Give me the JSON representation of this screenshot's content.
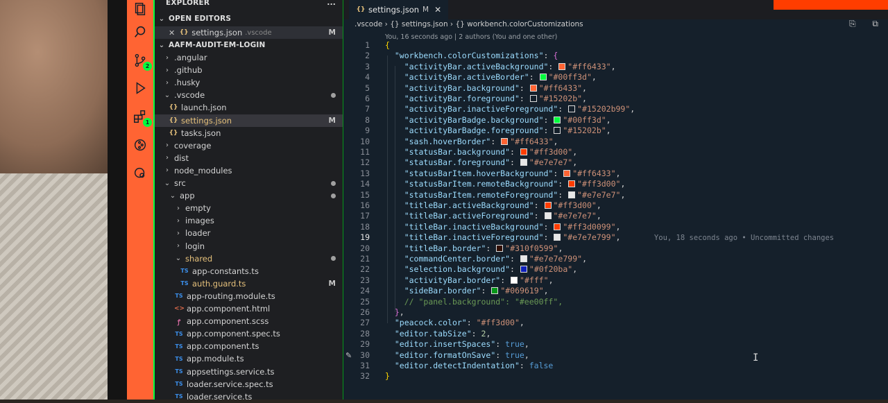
{
  "colors": {
    "activity_bar": "#ff6433",
    "activity_border": "#00ff3d",
    "editor_bg": "#15202b",
    "sidebar_border": "#069619",
    "title_bar": "#ff3d00"
  },
  "activity_bar": {
    "icons": [
      "explorer-icon",
      "search-icon",
      "source-control-icon",
      "run-debug-icon",
      "extensions-icon",
      "git-graph-icon",
      "remote-explorer-icon"
    ],
    "badges": {
      "source_control": "2",
      "extensions": "1"
    }
  },
  "sidebar": {
    "title": "EXPLORER",
    "more": "...",
    "open_editors_label": "OPEN EDITORS",
    "open_editor": {
      "close": "✕",
      "name": "settings.json",
      "folder": ".vscode",
      "status": "M"
    },
    "project_label": "AAFM-AUDIT-EM-LOGIN",
    "tree": [
      {
        "name": ".angular",
        "chevron": "›",
        "icon": ""
      },
      {
        "name": ".github",
        "chevron": "›",
        "icon": ""
      },
      {
        "name": ".husky",
        "chevron": "›",
        "icon": ""
      },
      {
        "name": ".vscode",
        "chevron": "⌄",
        "icon": "",
        "dot": true
      },
      {
        "name": "launch.json",
        "chevron": "",
        "icon": "{}"
      },
      {
        "name": "settings.json",
        "chevron": "",
        "icon": "{}",
        "status": "M",
        "active": true
      },
      {
        "name": "tasks.json",
        "chevron": "",
        "icon": "{}"
      },
      {
        "name": "coverage",
        "chevron": "›",
        "icon": ""
      },
      {
        "name": "dist",
        "chevron": "›",
        "icon": ""
      },
      {
        "name": "node_modules",
        "chevron": "›",
        "icon": ""
      },
      {
        "name": "src",
        "chevron": "⌄",
        "icon": "",
        "dot": true
      },
      {
        "name": "app",
        "chevron": "⌄",
        "icon": "",
        "dot": true
      },
      {
        "name": "empty",
        "chevron": "›",
        "icon": ""
      },
      {
        "name": "images",
        "chevron": "›",
        "icon": ""
      },
      {
        "name": "loader",
        "chevron": "›",
        "icon": ""
      },
      {
        "name": "login",
        "chevron": "›",
        "icon": ""
      },
      {
        "name": "shared",
        "chevron": "⌄",
        "icon": "",
        "dot": true
      },
      {
        "name": "app-constants.ts",
        "chevron": "",
        "icon": "TS"
      },
      {
        "name": "auth.guard.ts",
        "chevron": "",
        "icon": "TS",
        "status": "M"
      },
      {
        "name": "app-routing.module.ts",
        "chevron": "",
        "icon": "TS"
      },
      {
        "name": "app.component.html",
        "chevron": "",
        "icon": "<>"
      },
      {
        "name": "app.component.scss",
        "chevron": "",
        "icon": "ꝭ"
      },
      {
        "name": "app.component.spec.ts",
        "chevron": "",
        "icon": "TS"
      },
      {
        "name": "app.component.ts",
        "chevron": "",
        "icon": "TS"
      },
      {
        "name": "app.module.ts",
        "chevron": "",
        "icon": "TS"
      },
      {
        "name": "appsettings.service.ts",
        "chevron": "",
        "icon": "TS"
      },
      {
        "name": "loader.service.spec.ts",
        "chevron": "",
        "icon": "TS"
      },
      {
        "name": "loader.service.ts",
        "chevron": "",
        "icon": "TS"
      }
    ]
  },
  "editor": {
    "tab": {
      "icon": "{}",
      "label": "settings.json",
      "status": "M",
      "close": "✕"
    },
    "top_right_icons": "⎘ ⧉",
    "breadcrumb": ".vscode  ›  {} settings.json  ›  {} workbench.colorCustomizations",
    "blame_header": "You, 16 seconds ago | 2 authors (You and one other)",
    "inline_blame": "You, 18 seconds ago • Uncommitted changes",
    "current_line": "19",
    "lines": [
      {
        "n": "1",
        "parts": [
          [
            "br1",
            "{"
          ]
        ]
      },
      {
        "n": "2",
        "parts": [
          [
            "p",
            "  "
          ],
          [
            "k",
            "\"workbench.colorCustomizations\""
          ],
          [
            "p",
            ": "
          ],
          [
            "br2",
            "{"
          ]
        ]
      },
      {
        "n": "3",
        "parts": [
          [
            "p",
            "    "
          ],
          [
            "k",
            "\"activityBar.activeBackground\""
          ],
          [
            "p",
            ": "
          ],
          [
            "sw",
            "#ff6433"
          ],
          [
            "s",
            "\"#ff6433\""
          ],
          [
            "p",
            ","
          ]
        ]
      },
      {
        "n": "4",
        "parts": [
          [
            "p",
            "    "
          ],
          [
            "k",
            "\"activityBar.activeBorder\""
          ],
          [
            "p",
            ": "
          ],
          [
            "sw",
            "#00ff3d"
          ],
          [
            "s",
            "\"#00ff3d\""
          ],
          [
            "p",
            ","
          ]
        ]
      },
      {
        "n": "5",
        "parts": [
          [
            "p",
            "    "
          ],
          [
            "k",
            "\"activityBar.background\""
          ],
          [
            "p",
            ": "
          ],
          [
            "sw",
            "#ff6433"
          ],
          [
            "s",
            "\"#ff6433\""
          ],
          [
            "p",
            ","
          ]
        ]
      },
      {
        "n": "6",
        "parts": [
          [
            "p",
            "    "
          ],
          [
            "k",
            "\"activityBar.foreground\""
          ],
          [
            "p",
            ": "
          ],
          [
            "sw",
            "#15202b"
          ],
          [
            "s",
            "\"#15202b\""
          ],
          [
            "p",
            ","
          ]
        ]
      },
      {
        "n": "7",
        "parts": [
          [
            "p",
            "    "
          ],
          [
            "k",
            "\"activityBar.inactiveForeground\""
          ],
          [
            "p",
            ": "
          ],
          [
            "sw",
            "#15202b"
          ],
          [
            "s",
            "\"#15202b99\""
          ],
          [
            "p",
            ","
          ]
        ]
      },
      {
        "n": "8",
        "parts": [
          [
            "p",
            "    "
          ],
          [
            "k",
            "\"activityBarBadge.background\""
          ],
          [
            "p",
            ": "
          ],
          [
            "sw",
            "#00ff3d"
          ],
          [
            "s",
            "\"#00ff3d\""
          ],
          [
            "p",
            ","
          ]
        ]
      },
      {
        "n": "9",
        "parts": [
          [
            "p",
            "    "
          ],
          [
            "k",
            "\"activityBarBadge.foreground\""
          ],
          [
            "p",
            ": "
          ],
          [
            "sw",
            "#15202b"
          ],
          [
            "s",
            "\"#15202b\""
          ],
          [
            "p",
            ","
          ]
        ]
      },
      {
        "n": "10",
        "parts": [
          [
            "p",
            "    "
          ],
          [
            "k",
            "\"sash.hoverBorder\""
          ],
          [
            "p",
            ": "
          ],
          [
            "sw",
            "#ff6433"
          ],
          [
            "s",
            "\"#ff6433\""
          ],
          [
            "p",
            ","
          ]
        ]
      },
      {
        "n": "11",
        "parts": [
          [
            "p",
            "    "
          ],
          [
            "k",
            "\"statusBar.background\""
          ],
          [
            "p",
            ": "
          ],
          [
            "sw",
            "#ff3d00"
          ],
          [
            "s",
            "\"#ff3d00\""
          ],
          [
            "p",
            ","
          ]
        ]
      },
      {
        "n": "12",
        "parts": [
          [
            "p",
            "    "
          ],
          [
            "k",
            "\"statusBar.foreground\""
          ],
          [
            "p",
            ": "
          ],
          [
            "sw",
            "#e7e7e7"
          ],
          [
            "s",
            "\"#e7e7e7\""
          ],
          [
            "p",
            ","
          ]
        ]
      },
      {
        "n": "13",
        "parts": [
          [
            "p",
            "    "
          ],
          [
            "k",
            "\"statusBarItem.hoverBackground\""
          ],
          [
            "p",
            ": "
          ],
          [
            "sw",
            "#ff6433"
          ],
          [
            "s",
            "\"#ff6433\""
          ],
          [
            "p",
            ","
          ]
        ]
      },
      {
        "n": "14",
        "parts": [
          [
            "p",
            "    "
          ],
          [
            "k",
            "\"statusBarItem.remoteBackground\""
          ],
          [
            "p",
            ": "
          ],
          [
            "sw",
            "#ff3d00"
          ],
          [
            "s",
            "\"#ff3d00\""
          ],
          [
            "p",
            ","
          ]
        ]
      },
      {
        "n": "15",
        "parts": [
          [
            "p",
            "    "
          ],
          [
            "k",
            "\"statusBarItem.remoteForeground\""
          ],
          [
            "p",
            ": "
          ],
          [
            "sw",
            "#e7e7e7"
          ],
          [
            "s",
            "\"#e7e7e7\""
          ],
          [
            "p",
            ","
          ]
        ]
      },
      {
        "n": "16",
        "parts": [
          [
            "p",
            "    "
          ],
          [
            "k",
            "\"titleBar.activeBackground\""
          ],
          [
            "p",
            ": "
          ],
          [
            "sw",
            "#ff3d00"
          ],
          [
            "s",
            "\"#ff3d00\""
          ],
          [
            "p",
            ","
          ]
        ]
      },
      {
        "n": "17",
        "parts": [
          [
            "p",
            "    "
          ],
          [
            "k",
            "\"titleBar.activeForeground\""
          ],
          [
            "p",
            ": "
          ],
          [
            "sw",
            "#e7e7e7"
          ],
          [
            "s",
            "\"#e7e7e7\""
          ],
          [
            "p",
            ","
          ]
        ]
      },
      {
        "n": "18",
        "parts": [
          [
            "p",
            "    "
          ],
          [
            "k",
            "\"titleBar.inactiveBackground\""
          ],
          [
            "p",
            ": "
          ],
          [
            "sw",
            "#ff3d00"
          ],
          [
            "s",
            "\"#ff3d0099\""
          ],
          [
            "p",
            ","
          ]
        ]
      },
      {
        "n": "19",
        "parts": [
          [
            "p",
            "    "
          ],
          [
            "k",
            "\"titleBar.inactiveForeground\""
          ],
          [
            "p",
            ": "
          ],
          [
            "sw",
            "#e7e7e7"
          ],
          [
            "s",
            "\"#e7e7e799\""
          ],
          [
            "p",
            ",       "
          ],
          [
            "blame",
            ""
          ]
        ]
      },
      {
        "n": "20",
        "parts": [
          [
            "p",
            "    "
          ],
          [
            "k",
            "\"titleBar.border\""
          ],
          [
            "p",
            ": "
          ],
          [
            "sw",
            "#310f05"
          ],
          [
            "s",
            "\"#310f0599\""
          ],
          [
            "p",
            ","
          ]
        ]
      },
      {
        "n": "21",
        "parts": [
          [
            "p",
            "    "
          ],
          [
            "k",
            "\"commandCenter.border\""
          ],
          [
            "p",
            ": "
          ],
          [
            "sw",
            "#e7e7e7"
          ],
          [
            "s",
            "\"#e7e7e799\""
          ],
          [
            "p",
            ","
          ]
        ]
      },
      {
        "n": "22",
        "parts": [
          [
            "p",
            "    "
          ],
          [
            "k",
            "\"selection.background\""
          ],
          [
            "p",
            ": "
          ],
          [
            "sw",
            "#0f20ba"
          ],
          [
            "s",
            "\"#0f20ba\""
          ],
          [
            "p",
            ","
          ]
        ]
      },
      {
        "n": "23",
        "parts": [
          [
            "p",
            "    "
          ],
          [
            "k",
            "\"activityBar.border\""
          ],
          [
            "p",
            ": "
          ],
          [
            "sw",
            "#ffffff"
          ],
          [
            "s",
            "\"#fff\""
          ],
          [
            "p",
            ","
          ]
        ]
      },
      {
        "n": "24",
        "parts": [
          [
            "p",
            "    "
          ],
          [
            "k",
            "\"sideBar.border\""
          ],
          [
            "p",
            ": "
          ],
          [
            "sw",
            "#069619"
          ],
          [
            "s",
            "\"#069619\""
          ],
          [
            "p",
            ","
          ]
        ]
      },
      {
        "n": "25",
        "parts": [
          [
            "p",
            "    "
          ],
          [
            "c",
            "// \"panel.background\": \"#ee00ff\","
          ]
        ]
      },
      {
        "n": "26",
        "parts": [
          [
            "p",
            "  "
          ],
          [
            "br2",
            "}"
          ],
          [
            "p",
            ","
          ]
        ]
      },
      {
        "n": "27",
        "parts": [
          [
            "p",
            "  "
          ],
          [
            "k",
            "\"peacock.color\""
          ],
          [
            "p",
            ": "
          ],
          [
            "s",
            "\"#ff3d00\""
          ],
          [
            "p",
            ","
          ]
        ]
      },
      {
        "n": "28",
        "parts": [
          [
            "p",
            "  "
          ],
          [
            "k",
            "\"editor.tabSize\""
          ],
          [
            "p",
            ": "
          ],
          [
            "n",
            "2"
          ],
          [
            "p",
            ","
          ]
        ]
      },
      {
        "n": "29",
        "parts": [
          [
            "p",
            "  "
          ],
          [
            "k",
            "\"editor.insertSpaces\""
          ],
          [
            "p",
            ": "
          ],
          [
            "b",
            "true"
          ],
          [
            "p",
            ","
          ]
        ]
      },
      {
        "n": "30",
        "parts": [
          [
            "p",
            "  "
          ],
          [
            "k",
            "\"editor.formatOnSave\""
          ],
          [
            "p",
            ": "
          ],
          [
            "b",
            "true"
          ],
          [
            "p",
            ","
          ]
        ]
      },
      {
        "n": "31",
        "parts": [
          [
            "p",
            "  "
          ],
          [
            "k",
            "\"editor.detectIndentation\""
          ],
          [
            "p",
            ": "
          ],
          [
            "b",
            "false"
          ]
        ]
      },
      {
        "n": "32",
        "parts": [
          [
            "br1",
            "}"
          ]
        ]
      }
    ]
  }
}
